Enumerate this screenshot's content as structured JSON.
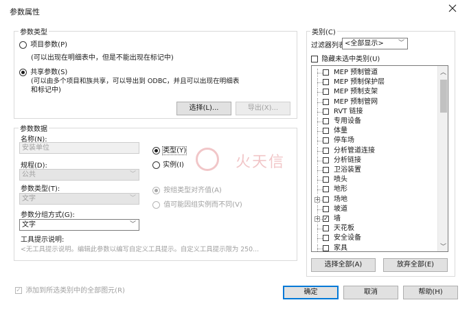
{
  "window": {
    "title": "参数属性"
  },
  "param_type_group": {
    "label": "参数类型",
    "project_param": {
      "label": "项目参数(P)",
      "desc": "(可以出现在明细表中，但是不能出现在标记中)"
    },
    "shared_param": {
      "label": "共享参数(S)",
      "desc_line1": "(可以由多个项目和族共享，可以导出到 ODBC，并且可以出现在明细表",
      "desc_line2": "和标记中)"
    },
    "select_button": "选择(L)...",
    "export_button": "导出(X)..."
  },
  "param_data_group": {
    "label": "参数数据",
    "name_label": "名称(N):",
    "name_placeholder": "安装单位",
    "type_radio": "类型(Y)",
    "instance_radio": "实例(I)",
    "discipline_label": "规程(D):",
    "discipline_value": "公共",
    "param_kind_label": "参数类型(T):",
    "param_kind_value": "文字",
    "group_by_label": "参数分组方式(G):",
    "group_by_value": "文字",
    "align_by_type": "按组类型对齐值(A)",
    "vary_by_group": "值可能因组实例而不同(V)",
    "tooltip_label": "工具提示说明:",
    "tooltip_text": "<无工具提示说明。编辑此参数以编写自定义工具提示。自定义工具提示限为 250..."
  },
  "category_group": {
    "label": "类别(C)",
    "filter_label": "过滤器列表:",
    "filter_value": "<全部显示>",
    "hide_unselected": "隐藏未选中类别(U)",
    "items": [
      {
        "label": "MEP 预制管道",
        "checked": false,
        "expandable": false
      },
      {
        "label": "MEP 预制保护层",
        "checked": false,
        "expandable": false
      },
      {
        "label": "MEP 预制支架",
        "checked": false,
        "expandable": false
      },
      {
        "label": "MEP 预制管网",
        "checked": false,
        "expandable": false
      },
      {
        "label": "RVT 链接",
        "checked": false,
        "expandable": false
      },
      {
        "label": "专用设备",
        "checked": false,
        "expandable": false
      },
      {
        "label": "体量",
        "checked": false,
        "expandable": false
      },
      {
        "label": "停车场",
        "checked": false,
        "expandable": false
      },
      {
        "label": "分析管道连接",
        "checked": false,
        "expandable": false
      },
      {
        "label": "分析链接",
        "checked": false,
        "expandable": false
      },
      {
        "label": "卫浴装置",
        "checked": false,
        "expandable": false
      },
      {
        "label": "喷头",
        "checked": false,
        "expandable": false
      },
      {
        "label": "地形",
        "checked": false,
        "expandable": false
      },
      {
        "label": "场地",
        "checked": false,
        "expandable": true
      },
      {
        "label": "坡道",
        "checked": false,
        "expandable": false
      },
      {
        "label": "墙",
        "checked": true,
        "expandable": true
      },
      {
        "label": "天花板",
        "checked": false,
        "expandable": false
      },
      {
        "label": "安全设备",
        "checked": false,
        "expandable": false
      },
      {
        "label": "家具",
        "checked": false,
        "expandable": false
      }
    ],
    "select_all": "选择全部(A)",
    "deselect_all": "放弃全部(E)"
  },
  "footer": {
    "add_to_all": "添加到所选类别中的全部图元(R)",
    "ok": "确定",
    "cancel": "取消",
    "help": "帮助(H)"
  },
  "watermark": {
    "text": "火天信"
  },
  "colors": {
    "accent": "#0078d7",
    "watermark": "#c81d25"
  }
}
